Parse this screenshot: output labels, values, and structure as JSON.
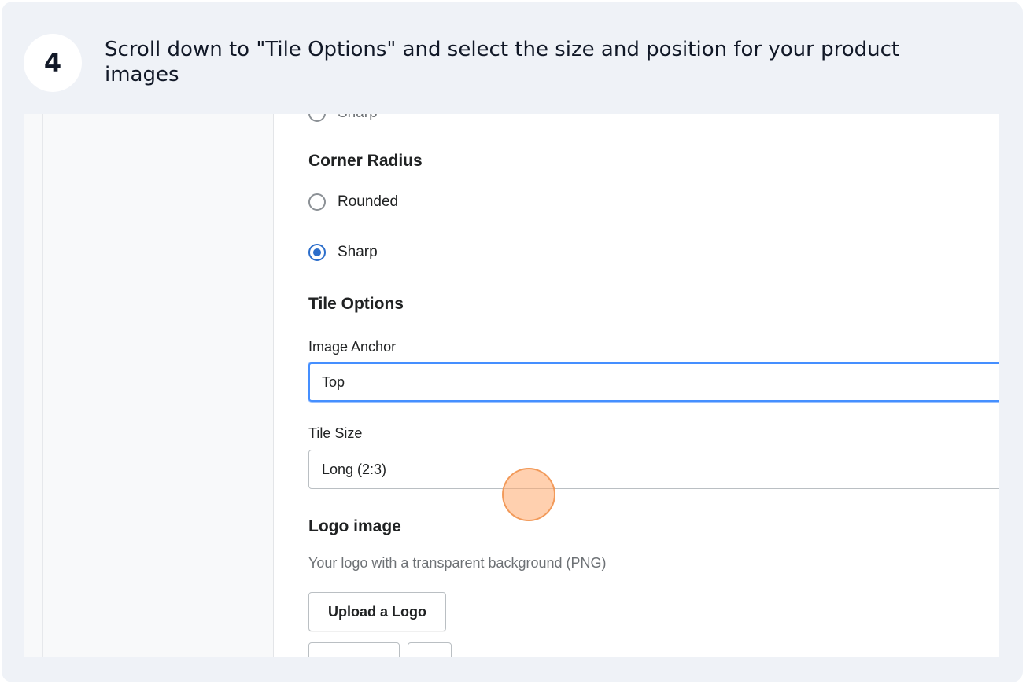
{
  "step": {
    "number": "4",
    "instruction": "Scroll down to \"Tile Options\" and select the size and position for your product images"
  },
  "form": {
    "top_partial_radio_label": "Sharp",
    "corner_radius": {
      "heading": "Corner Radius",
      "options": [
        {
          "label": "Rounded",
          "checked": false
        },
        {
          "label": "Sharp",
          "checked": true
        }
      ]
    },
    "tile_options": {
      "heading": "Tile Options",
      "image_anchor": {
        "label": "Image Anchor",
        "value": "Top"
      },
      "tile_size": {
        "label": "Tile Size",
        "value": "Long (2:3)"
      }
    },
    "logo_image": {
      "heading": "Logo image",
      "help_text": "Your logo with a transparent background (PNG)",
      "upload_button": "Upload a Logo"
    }
  },
  "colors": {
    "accent": "#2c6ecb",
    "focus_ring": "#458fff",
    "click_marker": "#f5a46a"
  }
}
